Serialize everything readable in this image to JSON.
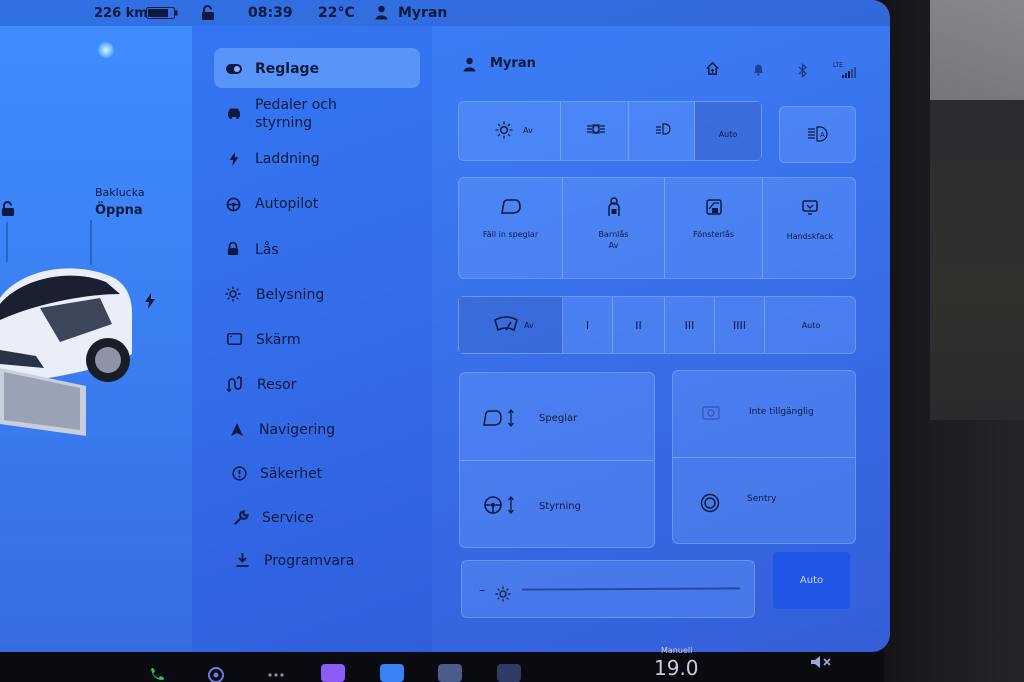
{
  "status": {
    "range": "226 km",
    "time": "08:39",
    "temperature": "22°C",
    "profile": "Myran"
  },
  "car": {
    "trunk_label": "Baklucka",
    "trunk_action": "Öppna"
  },
  "nav": {
    "items": [
      {
        "label": "Reglage",
        "icon": "toggle-icon"
      },
      {
        "label": "Pedaler och",
        "label2": "styrning",
        "icon": "car-icon"
      },
      {
        "label": "Laddning",
        "icon": "bolt-icon"
      },
      {
        "label": "Autopilot",
        "icon": "steering-wheel-icon"
      },
      {
        "label": "Lås",
        "icon": "lock-icon"
      },
      {
        "label": "Belysning",
        "icon": "sun-icon"
      },
      {
        "label": "Skärm",
        "icon": "display-icon"
      },
      {
        "label": "Resor",
        "icon": "trips-icon"
      },
      {
        "label": "Navigering",
        "icon": "navigation-arrow-icon"
      },
      {
        "label": "Säkerhet",
        "icon": "alert-circle-icon"
      },
      {
        "label": "Service",
        "icon": "wrench-icon"
      },
      {
        "label": "Programvara",
        "icon": "download-icon"
      }
    ]
  },
  "header": {
    "profile_name": "Myran",
    "lte": "LTE"
  },
  "lights": {
    "off": "Av",
    "auto": "Auto"
  },
  "controls": {
    "fold_mirrors": "Fäll in speglar",
    "child_lock": "Barnlås",
    "child_lock_state": "Av",
    "window_lock": "Fönsterlås",
    "glovebox": "Handskfack"
  },
  "wipers": {
    "off": "Av",
    "speeds": [
      "I",
      "II",
      "III",
      "IIII"
    ],
    "auto": "Auto"
  },
  "adjust": {
    "mirrors": "Speglar",
    "steering": "Styrning",
    "unavailable": "Inte tillgänglig",
    "sentry": "Sentry"
  },
  "brightness": {
    "minus": "–",
    "auto": "Auto"
  },
  "dock": {
    "climate_mode": "Manuell",
    "temp": "19.0"
  },
  "colors": {
    "display": "#3a7af0",
    "accent": "#1f56e6",
    "text": "#0f1a3d"
  }
}
